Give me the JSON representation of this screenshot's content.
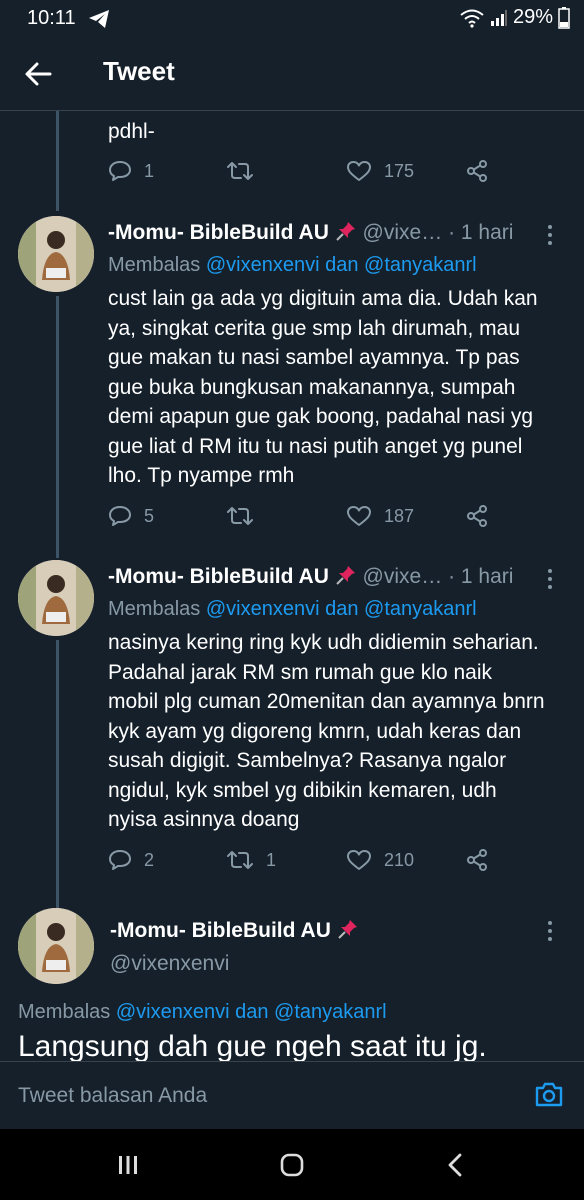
{
  "status_bar": {
    "time": "10:11",
    "battery": "29%"
  },
  "header": {
    "title": "Tweet"
  },
  "prev_tweet": {
    "text_tail": "pdhl-",
    "replies": "1",
    "retweets": "",
    "likes": "175"
  },
  "tweets": [
    {
      "name": "-Momu- BibleBuild AU",
      "handle": "@vixe…",
      "time": "· 1 hari",
      "reply_prefix": "Membalas",
      "mention1": "@vixenxenvi",
      "conj": "dan",
      "mention2": "@tanyakanrl",
      "body": "cust lain ga ada yg digituin ama dia. Udah kan ya, singkat cerita gue smp lah dirumah, mau gue makan tu nasi sambel ayamnya. Tp pas gue buka bungkusan makanannya, sumpah demi apapun gue gak boong, padahal nasi yg gue liat d RM itu tu nasi putih anget yg punel lho. Tp nyampe rmh",
      "replies": "5",
      "retweets": "",
      "likes": "187"
    },
    {
      "name": "-Momu- BibleBuild AU",
      "handle": "@vixe…",
      "time": "· 1 hari",
      "reply_prefix": "Membalas",
      "mention1": "@vixenxenvi",
      "conj": "dan",
      "mention2": "@tanyakanrl",
      "body": "nasinya kering ring kyk udh didiemin seharian. Padahal jarak RM sm rumah gue klo naik mobil plg cuman 20menitan dan ayamnya bnrn kyk ayam yg digoreng kmrn, udah keras dan susah digigit. Sambelnya? Rasanya ngalor ngidul, kyk smbel yg dibikin kemaren, udh nyisa asinnya doang",
      "replies": "2",
      "retweets": "1",
      "likes": "210"
    }
  ],
  "focused": {
    "name": "-Momu- BibleBuild AU",
    "handle": "@vixenxenvi",
    "reply_prefix": "Membalas",
    "mention1": "@vixenxenvi",
    "conj": "dan",
    "mention2": "@tanyakanrl",
    "body": "Langsung dah gue ngeh saat itu jg."
  },
  "reply_input": {
    "placeholder": "Tweet balasan Anda"
  },
  "colors": {
    "background": "#15202b",
    "accent": "#1d9bf0",
    "muted": "#8899a6",
    "pin": "#e0245e"
  }
}
